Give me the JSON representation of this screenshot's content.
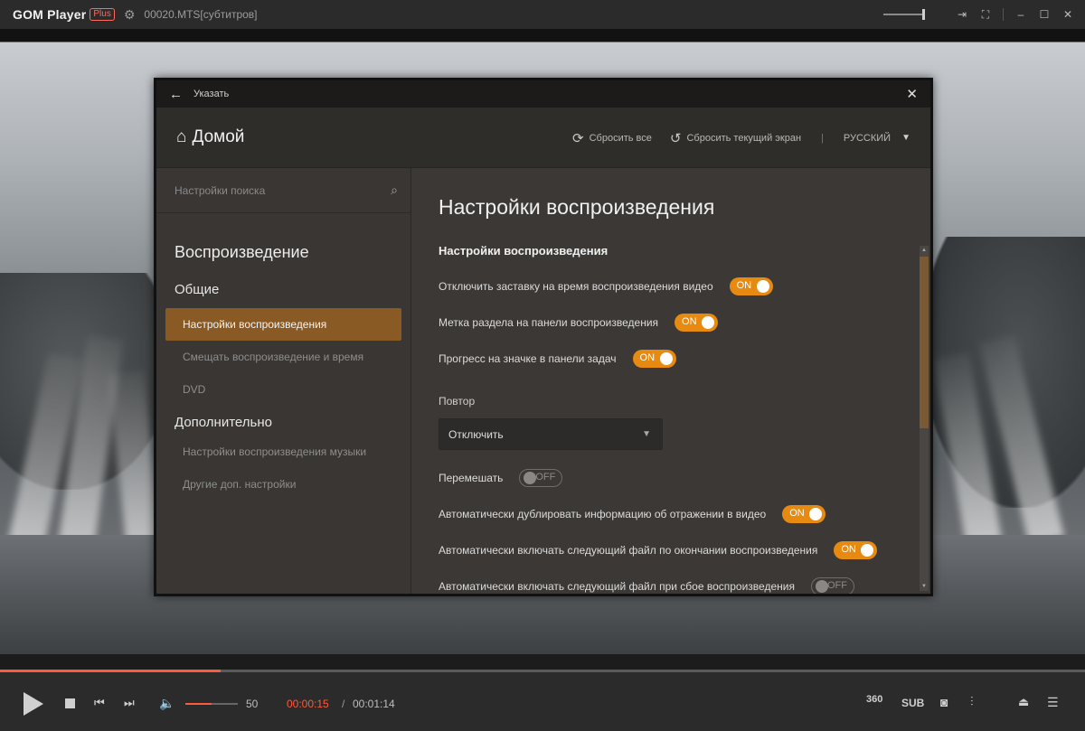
{
  "titlebar": {
    "logo": "GOM Player",
    "plus_badge": "Plus",
    "filename": "00020.MTS[субтитров]",
    "icons": [
      "settings-gear-icon",
      "pin-icon",
      "fullscreen-icon",
      "minimize-icon",
      "maximize-icon",
      "close-icon"
    ]
  },
  "dialog": {
    "title": "Указать",
    "home": "Домой",
    "reset_all": "Сбросить все",
    "reset_current": "Сбросить текущий экран",
    "language": "РУССКИЙ",
    "separator": "|"
  },
  "sidebar": {
    "search_placeholder": "Настройки поиска",
    "heading": "Воспроизведение",
    "group1": "Общие",
    "group1_items": [
      {
        "label": "Настройки воспроизведения",
        "active": true
      },
      {
        "label": "Смещать воспроизведение и время",
        "active": false
      },
      {
        "label": "DVD",
        "active": false
      }
    ],
    "group2": "Дополнительно",
    "group2_items": [
      {
        "label": "Настройки воспроизведения музыки",
        "active": false
      },
      {
        "label": "Другие доп. настройки",
        "active": false
      }
    ]
  },
  "content": {
    "title": "Настройки воспроизведения",
    "section": "Настройки воспроизведения",
    "options": [
      {
        "label": "Отключить заставку на время воспроизведения видео",
        "state": "ON"
      },
      {
        "label": "Метка раздела на панели воспроизведения",
        "state": "ON"
      },
      {
        "label": "Прогресс на значке в панели задач",
        "state": "ON"
      }
    ],
    "repeat_label": "Повтор",
    "repeat_value": "Отключить",
    "shuffle_label": "Перемешать",
    "shuffle_state": "OFF",
    "more_options": [
      {
        "label": "Автоматически дублировать информацию об отражении в видео",
        "state": "ON"
      },
      {
        "label": "Автоматически включать следующий файл по окончании воспроизведения",
        "state": "ON"
      },
      {
        "label": "Автоматически включать следующий файл при сбое воспроизведения",
        "state": "OFF"
      }
    ]
  },
  "controls": {
    "volume_value": "50",
    "volume_fraction": 0.5,
    "time_current": "00:00:15",
    "time_separator": "/",
    "time_total": "00:01:14",
    "progress_fraction": 0.203,
    "label_360": "360",
    "label_sub": "SUB"
  },
  "colors": {
    "accent_orange": "#e68a12",
    "progress_red": "#ff5a3c",
    "sidebar_active": "#8a5a25"
  }
}
